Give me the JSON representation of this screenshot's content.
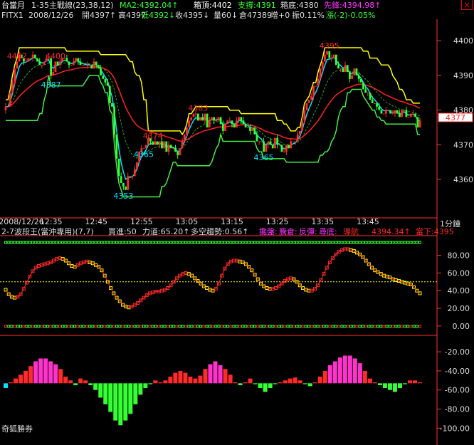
{
  "header": {
    "title": "台當月",
    "study": "1-35主戰線(23,38,12)",
    "ma2": "MA2:4392.04↑",
    "box_top": "箱頂:4402",
    "support": "支撐:4391",
    "box_bottom": "箱底:4380",
    "pioneer": "先鋒:4394.98↑",
    "close_symbol": "×"
  },
  "quote": {
    "symbol": "FITX1",
    "date": "2008/12/26",
    "open": "開4397↑",
    "high": "高4397",
    "low": "低4392↓",
    "close": "收4395↓",
    "volume": "量60↓",
    "oi": "倉47389",
    "oi_change": "增+0",
    "amplitude": "振0.11%",
    "change": "漲(-2)-0.05%"
  },
  "osc_header": {
    "name": "2-7波段王(當沖專用)(7,7)",
    "buy": "買進:50",
    "force": "力道:65.20↑",
    "trend": "多空趨勢:0.56↑",
    "lights": "攙盤:",
    "warehouse": "騰倉:",
    "rebound": "反彈:",
    "bottom": "尋底:",
    "nav": "導航",
    "nav_value": "4394.34↑",
    "current": "當下:4395"
  },
  "footer": {
    "brand": "奇狐勝券"
  },
  "price_badge": "4377",
  "interval_label": "1分鐘",
  "colors": {
    "up": "#ff2a2a",
    "down": "#33ff33",
    "yellow": "#ffff00",
    "cyan": "#00e5ff",
    "magenta": "#ff33ff",
    "red_line": "#ff2020",
    "green_line": "#44ee44",
    "axis": "#ff3030",
    "text": "#dddddd"
  },
  "chart_data": [
    {
      "type": "candlestick",
      "x_tick_labels": [
        "2008/12/26",
        "12:35",
        "12:45",
        "12:55",
        "13:05",
        "13:15",
        "13:25",
        "13:35",
        "13:45"
      ],
      "y_ticks": [
        4360,
        4370,
        4380,
        4390,
        4400
      ],
      "ylim": [
        4351,
        4406
      ],
      "annotations": [
        {
          "bar": 5,
          "label": "4402",
          "color": "red"
        },
        {
          "bar": 22,
          "label": "4400",
          "color": "red"
        },
        {
          "bar": 20,
          "label": "4387",
          "color": "cyan"
        },
        {
          "bar": 85,
          "label": "4383",
          "color": "red"
        },
        {
          "bar": 65,
          "label": "4374",
          "color": "red"
        },
        {
          "bar": 61,
          "label": "4365",
          "color": "cyan"
        },
        {
          "bar": 52,
          "label": "4353",
          "color": "cyan"
        },
        {
          "bar": 114,
          "label": "4365",
          "color": "cyan"
        },
        {
          "bar": 143,
          "label": "4395",
          "color": "red"
        }
      ],
      "opens": [
        4380,
        4381,
        4381,
        4385,
        4388,
        4392,
        4394,
        4396,
        4395,
        4394,
        4394,
        4395,
        4395,
        4396,
        4395,
        4394,
        4393,
        4393,
        4394,
        4395,
        4395,
        4390,
        4391,
        4394,
        4393,
        4394,
        4395,
        4395,
        4394,
        4393,
        4393,
        4394,
        4395,
        4394,
        4393,
        4393,
        4393,
        4393,
        4393,
        4392,
        4394,
        4393,
        4392,
        4390,
        4389,
        4388,
        4387,
        4382,
        4381,
        4373,
        4366,
        4361,
        4359,
        4358,
        4357,
        4361,
        4361,
        4361,
        4363,
        4365,
        4368,
        4369,
        4369,
        4370,
        4372,
        4371,
        4370,
        4371,
        4370,
        4371,
        4369,
        4371,
        4368,
        4370,
        4369,
        4369,
        4368,
        4367,
        4369,
        4371,
        4373,
        4375,
        4377,
        4378,
        4379,
        4379,
        4377,
        4378,
        4377,
        4379,
        4375,
        4377,
        4378,
        4377,
        4377,
        4378,
        4376,
        4374,
        4376,
        4377,
        4377,
        4376,
        4375,
        4377,
        4378,
        4377,
        4376,
        4375,
        4375,
        4374,
        4375,
        4373,
        4371,
        4371,
        4371,
        4368,
        4370,
        4371,
        4370,
        4369,
        4372,
        4370,
        4370,
        4368,
        4368,
        4370,
        4369,
        4371,
        4371,
        4371,
        4373,
        4374,
        4377,
        4380,
        4382,
        4383,
        4384,
        4387,
        4387,
        4389,
        4392,
        4394,
        4396,
        4397,
        4395,
        4395,
        4396,
        4393,
        4392,
        4392,
        4391,
        4393,
        4391,
        4389,
        4390,
        4392,
        4390,
        4389,
        4388,
        4386,
        4385,
        4385,
        4383,
        4382,
        4382,
        4381,
        4380,
        4379,
        4379,
        4380,
        4380,
        4379,
        4379,
        4380,
        4379,
        4378,
        4380,
        4380,
        4378,
        4378,
        4379,
        4379,
        4378,
        4375
      ],
      "closes": [
        4381,
        4381,
        4385,
        4388,
        4392,
        4394,
        4396,
        4395,
        4394,
        4394,
        4395,
        4395,
        4396,
        4395,
        4394,
        4393,
        4393,
        4394,
        4395,
        4395,
        4390,
        4391,
        4394,
        4393,
        4394,
        4395,
        4395,
        4394,
        4393,
        4393,
        4394,
        4395,
        4394,
        4393,
        4393,
        4393,
        4393,
        4393,
        4392,
        4394,
        4393,
        4392,
        4390,
        4389,
        4388,
        4387,
        4382,
        4381,
        4373,
        4366,
        4361,
        4359,
        4358,
        4357,
        4361,
        4361,
        4361,
        4363,
        4365,
        4368,
        4369,
        4369,
        4370,
        4372,
        4371,
        4370,
        4371,
        4370,
        4371,
        4369,
        4371,
        4368,
        4370,
        4369,
        4369,
        4368,
        4367,
        4369,
        4371,
        4373,
        4375,
        4377,
        4378,
        4379,
        4379,
        4377,
        4378,
        4377,
        4379,
        4375,
        4377,
        4378,
        4377,
        4377,
        4378,
        4376,
        4374,
        4376,
        4377,
        4377,
        4376,
        4375,
        4377,
        4378,
        4377,
        4376,
        4375,
        4375,
        4374,
        4375,
        4373,
        4371,
        4371,
        4371,
        4368,
        4370,
        4371,
        4370,
        4369,
        4372,
        4370,
        4370,
        4368,
        4368,
        4370,
        4369,
        4371,
        4371,
        4371,
        4373,
        4374,
        4377,
        4380,
        4382,
        4383,
        4384,
        4387,
        4387,
        4389,
        4392,
        4394,
        4396,
        4397,
        4395,
        4395,
        4396,
        4393,
        4392,
        4392,
        4391,
        4393,
        4391,
        4389,
        4390,
        4392,
        4390,
        4389,
        4388,
        4386,
        4385,
        4385,
        4383,
        4382,
        4382,
        4381,
        4380,
        4379,
        4379,
        4380,
        4380,
        4379,
        4379,
        4380,
        4379,
        4378,
        4380,
        4380,
        4378,
        4378,
        4379,
        4379,
        4378,
        4375,
        4377
      ]
    },
    {
      "type": "line",
      "x_tick_labels": [
        "2008/12/26",
        "12:35",
        "12:45",
        "12:55",
        "13:05",
        "13:15",
        "13:25",
        "13:35",
        "13:45"
      ],
      "y_ticks": [
        0,
        20,
        40,
        60,
        80
      ],
      "ylim": [
        -5,
        95
      ],
      "reference_line": 50,
      "series_values": [
        41,
        36,
        33,
        32,
        33,
        36,
        42,
        49,
        56,
        62,
        66,
        68,
        69,
        70,
        71,
        72,
        74,
        76,
        77,
        76,
        74,
        71,
        68,
        67,
        69,
        71,
        72,
        73,
        72,
        71,
        69,
        67,
        63,
        57,
        50,
        43,
        37,
        32,
        28,
        24,
        22,
        21,
        22,
        24,
        26,
        29,
        32,
        35,
        37,
        38,
        39,
        39,
        40,
        41,
        43,
        46,
        50,
        54,
        57,
        59,
        60,
        59,
        57,
        54,
        51,
        48,
        45,
        43,
        41,
        40,
        42,
        48,
        57,
        65,
        70,
        73,
        74,
        74,
        73,
        72,
        70,
        67,
        63,
        58,
        53,
        48,
        45,
        43,
        42,
        42,
        43,
        45,
        48,
        51,
        53,
        54,
        53,
        50,
        46,
        43,
        41,
        40,
        40,
        42,
        46,
        52,
        59,
        66,
        72,
        77,
        81,
        84,
        86,
        87,
        87,
        86,
        85,
        83,
        81,
        78,
        74,
        70,
        66,
        63,
        61,
        59,
        57,
        56,
        55,
        53,
        52,
        51,
        50,
        49,
        48,
        47,
        44,
        40,
        37
      ]
    },
    {
      "type": "bar",
      "x_tick_labels": [
        "2008/12/26",
        "12:35",
        "12:45",
        "12:55",
        "13:05",
        "13:15",
        "13:25",
        "13:35",
        "13:45"
      ],
      "y_ticks": [
        -20,
        -40,
        -60,
        -80,
        -100
      ],
      "ylim": [
        -102,
        -8
      ],
      "values": [
        -58,
        -52,
        -48,
        -44,
        -40,
        -35,
        -30,
        -27,
        -27,
        -30,
        -33,
        -38,
        -46,
        -50,
        -55,
        -48,
        -50,
        -55,
        -60,
        -68,
        -75,
        -83,
        -92,
        -97,
        -92,
        -85,
        -75,
        -65,
        -58,
        -54,
        -50,
        -52,
        -50,
        -46,
        -42,
        -40,
        -42,
        -46,
        -48,
        -45,
        -38,
        -33,
        -30,
        -34,
        -38,
        -44,
        -52,
        -55,
        -52,
        -48,
        -54,
        -58,
        -62,
        -58,
        -54,
        -52,
        -50,
        -48,
        -47,
        -50,
        -54,
        -56,
        -52,
        -46,
        -40,
        -34,
        -30,
        -26,
        -24,
        -24,
        -27,
        -32,
        -40,
        -48,
        -52,
        -55,
        -58,
        -60,
        -62,
        -58,
        -54,
        -50,
        -50,
        -52
      ]
    }
  ]
}
